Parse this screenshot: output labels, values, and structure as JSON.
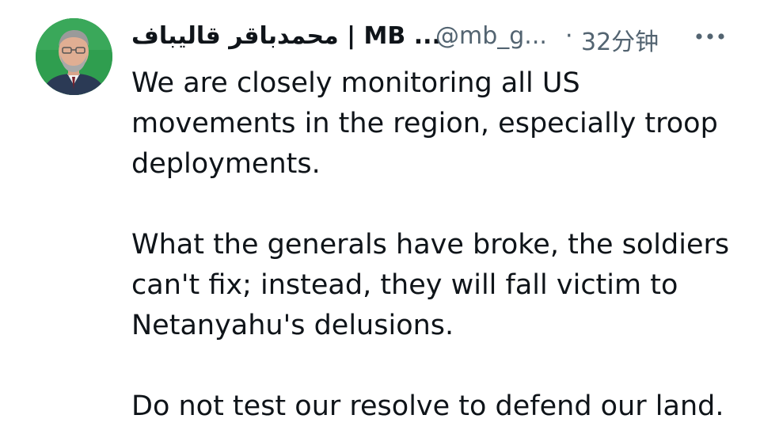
{
  "tweet": {
    "author": {
      "display_name": "محمدباقر قالیباف | MB ...",
      "handle": "@mb_g...",
      "separator": "·",
      "timestamp": "32分钟",
      "avatar_icon": "profile-photo-man"
    },
    "more_icon": "ellipsis-icon",
    "paragraphs": [
      {
        "lines": [
          "We are closely monitoring all US",
          "movements in the region, especially troop",
          "deployments."
        ]
      },
      {
        "lines": [
          "What the generals have broke, the soldiers",
          "can't fix; instead, they will fall victim to",
          "Netanyahu's delusions."
        ]
      },
      {
        "lines": [
          "Do not test our resolve to defend our land."
        ]
      }
    ]
  },
  "colors": {
    "text_primary": "#0f1419",
    "text_secondary": "#536471",
    "avatar_background": "#2c9a4a"
  }
}
